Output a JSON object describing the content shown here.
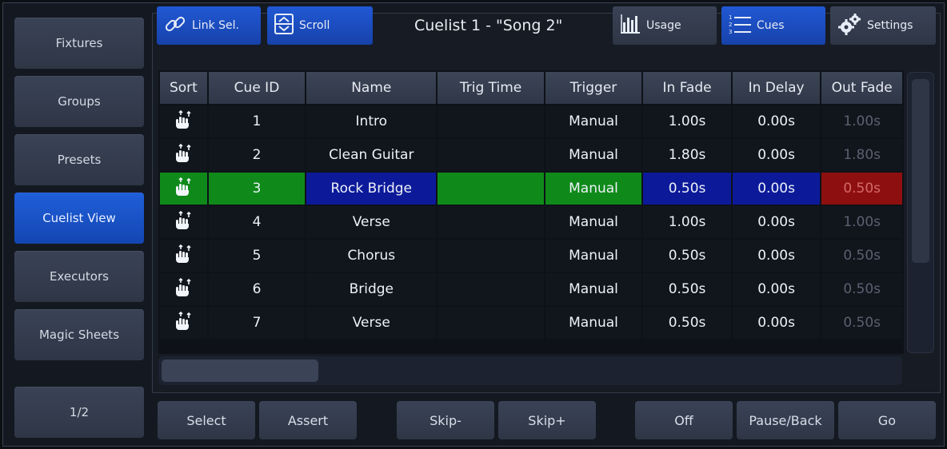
{
  "sidebar": {
    "items": [
      {
        "label": "Fixtures"
      },
      {
        "label": "Groups"
      },
      {
        "label": "Presets"
      },
      {
        "label": "Cuelist View"
      },
      {
        "label": "Executors"
      },
      {
        "label": "Magic Sheets"
      }
    ],
    "page_label": "1/2"
  },
  "toolbar": {
    "link_sel_label": "Link Sel.",
    "scroll_label": "Scroll",
    "title": "Cuelist 1 - \"Song 2\"",
    "usage_label": "Usage",
    "cues_label": "Cues",
    "settings_label": "Settings"
  },
  "table": {
    "headers": [
      "Sort",
      "Cue ID",
      "Name",
      "Trig Time",
      "Trigger",
      "In Fade",
      "In Delay",
      "Out Fade"
    ],
    "rows": [
      {
        "cue_id": "1",
        "name": "Intro",
        "trig_time": "",
        "trigger": "Manual",
        "in_fade": "1.00s",
        "in_delay": "0.00s",
        "out_fade": "1.00s"
      },
      {
        "cue_id": "2",
        "name": "Clean Guitar",
        "trig_time": "",
        "trigger": "Manual",
        "in_fade": "1.80s",
        "in_delay": "0.00s",
        "out_fade": "1.80s"
      },
      {
        "cue_id": "3",
        "name": "Rock Bridge",
        "trig_time": "",
        "trigger": "Manual",
        "in_fade": "0.50s",
        "in_delay": "0.00s",
        "out_fade": "0.50s"
      },
      {
        "cue_id": "4",
        "name": "Verse",
        "trig_time": "",
        "trigger": "Manual",
        "in_fade": "1.00s",
        "in_delay": "0.00s",
        "out_fade": "1.00s"
      },
      {
        "cue_id": "5",
        "name": "Chorus",
        "trig_time": "",
        "trigger": "Manual",
        "in_fade": "0.50s",
        "in_delay": "0.00s",
        "out_fade": "0.50s"
      },
      {
        "cue_id": "6",
        "name": "Bridge",
        "trig_time": "",
        "trigger": "Manual",
        "in_fade": "0.50s",
        "in_delay": "0.00s",
        "out_fade": "0.50s"
      },
      {
        "cue_id": "7",
        "name": "Verse",
        "trig_time": "",
        "trigger": "Manual",
        "in_fade": "0.50s",
        "in_delay": "0.00s",
        "out_fade": "0.50s"
      }
    ],
    "selected_row_index": 2
  },
  "bottom": {
    "select_label": "Select",
    "assert_label": "Assert",
    "skip_minus_label": "Skip-",
    "skip_plus_label": "Skip+",
    "off_label": "Off",
    "pause_back_label": "Pause/Back",
    "go_label": "Go"
  },
  "colors": {
    "accent_blue": "#1f5fd9",
    "selected_green": "#0f8a1a",
    "selected_blue": "#0c1a9a",
    "selected_red": "#8e0f0f"
  }
}
